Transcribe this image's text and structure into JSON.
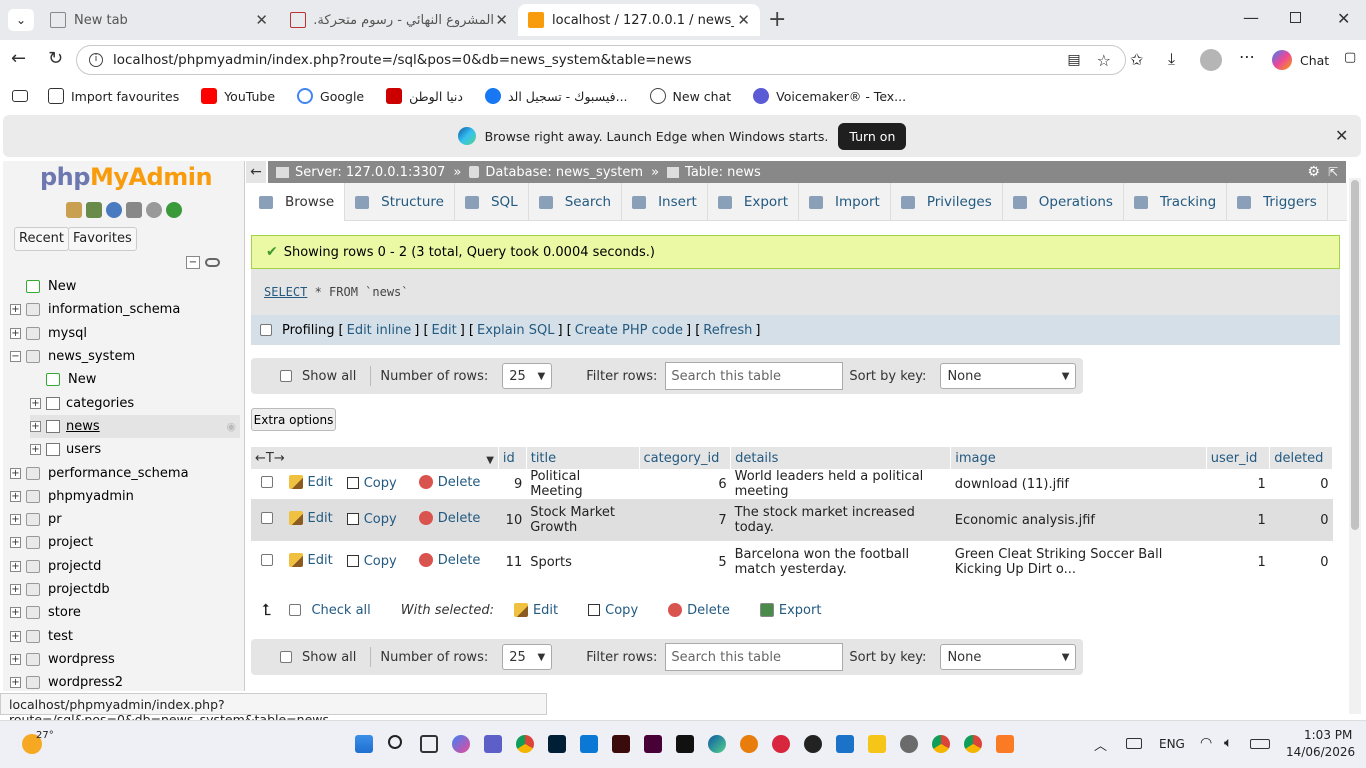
{
  "browser": {
    "tabs": [
      {
        "title": "New tab"
      },
      {
        "title": "المشروع النهائي - رسوم متحركة.pdf"
      },
      {
        "title": "localhost / 127.0.0.1 / news_system"
      }
    ],
    "new_tab_symbol": "+",
    "url": "localhost/phpmyadmin/index.php?route=/sql&pos=0&db=news_system&table=news",
    "chat_label": "Chat",
    "favourites": [
      "Import favourites",
      "YouTube",
      "Google",
      "دنيا الوطن",
      "فيسبوك - تسجيل الد...",
      "New chat",
      "Voicemaker® - Tex..."
    ],
    "infobar": {
      "message": "Browse right away. Launch Edge when Windows starts.",
      "button": "Turn on"
    },
    "status_url": "localhost/phpmyadmin/index.php?route=/sql&pos=0&db=news_system&table=news"
  },
  "pma": {
    "logo": {
      "part1": "php",
      "part2": "MyAdmin"
    },
    "recent_label": "Recent",
    "favorites_label": "Favorites",
    "tree": [
      {
        "label": "New",
        "level": 0,
        "type": "new"
      },
      {
        "label": "information_schema",
        "level": 0,
        "type": "db",
        "expander": "+"
      },
      {
        "label": "mysql",
        "level": 0,
        "type": "db",
        "expander": "+"
      },
      {
        "label": "news_system",
        "level": 0,
        "type": "db",
        "expander": "−"
      },
      {
        "label": "New",
        "level": 1,
        "type": "new"
      },
      {
        "label": "categories",
        "level": 1,
        "type": "table",
        "expander": "+"
      },
      {
        "label": "news",
        "level": 1,
        "type": "table",
        "expander": "+",
        "selected": true
      },
      {
        "label": "users",
        "level": 1,
        "type": "table",
        "expander": "+"
      },
      {
        "label": "performance_schema",
        "level": 0,
        "type": "db",
        "expander": "+"
      },
      {
        "label": "phpmyadmin",
        "level": 0,
        "type": "db",
        "expander": "+"
      },
      {
        "label": "pr",
        "level": 0,
        "type": "db",
        "expander": "+"
      },
      {
        "label": "project",
        "level": 0,
        "type": "db",
        "expander": "+"
      },
      {
        "label": "projectd",
        "level": 0,
        "type": "db",
        "expander": "+"
      },
      {
        "label": "projectdb",
        "level": 0,
        "type": "db",
        "expander": "+"
      },
      {
        "label": "store",
        "level": 0,
        "type": "db",
        "expander": "+"
      },
      {
        "label": "test",
        "level": 0,
        "type": "db",
        "expander": "+"
      },
      {
        "label": "wordpress",
        "level": 0,
        "type": "db",
        "expander": "+"
      },
      {
        "label": "wordpress2",
        "level": 0,
        "type": "db",
        "expander": "+"
      }
    ],
    "breadcrumb": {
      "server": "Server: 127.0.0.1:3307",
      "database": "Database: news_system",
      "table": "Table: news",
      "sep": "»"
    },
    "tabs": [
      "Browse",
      "Structure",
      "SQL",
      "Search",
      "Insert",
      "Export",
      "Import",
      "Privileges",
      "Operations",
      "Tracking",
      "Triggers"
    ],
    "success_msg": "Showing rows 0 - 2 (3 total, Query took 0.0004 seconds.)",
    "sql": {
      "keyword": "SELECT",
      "rest": " * FROM `news`"
    },
    "profiling": {
      "label": "Profiling",
      "links": [
        "Edit inline",
        "Edit",
        "Explain SQL",
        "Create PHP code",
        "Refresh"
      ]
    },
    "filter": {
      "show_all": "Show all",
      "num_rows_label": "Number of rows:",
      "num_rows_value": "25",
      "filter_label": "Filter rows:",
      "filter_placeholder": "Search this table",
      "sort_label": "Sort by key:",
      "sort_value": "None"
    },
    "extra_options": "Extra options",
    "columns": [
      "id",
      "title",
      "category_id",
      "details",
      "image",
      "user_id",
      "deleted"
    ],
    "row_actions": {
      "edit": "Edit",
      "copy": "Copy",
      "delete": "Delete"
    },
    "rows": [
      {
        "id": "9",
        "title": "Political Meeting",
        "category_id": "6",
        "details": "World leaders held a political meeting",
        "image": "download (11).jfif",
        "user_id": "1",
        "deleted": "0"
      },
      {
        "id": "10",
        "title": "Stock Market Growth",
        "category_id": "7",
        "details": "The stock market increased today.",
        "image": "Economic analysis.jfif",
        "user_id": "1",
        "deleted": "0"
      },
      {
        "id": "11",
        "title": "Sports",
        "category_id": "5",
        "details": "Barcelona won the football match yesterday.",
        "image": "Green Cleat Striking Soccer Ball Kicking Up Dirt o...",
        "user_id": "1",
        "deleted": "0"
      }
    ],
    "with_selected": {
      "check_all": "Check all",
      "label": "With selected:",
      "edit": "Edit",
      "copy": "Copy",
      "delete": "Delete",
      "export": "Export"
    }
  },
  "taskbar": {
    "temp": "27°",
    "lang": "ENG",
    "time": "1:03 PM",
    "date": "14/06/2026"
  },
  "colors": {
    "link": "#235a81",
    "success_bg": "#ebf8a4",
    "breadcrumb_bg": "#888888",
    "logo_php": "#6c78af",
    "logo_admin": "#f89c0e"
  }
}
